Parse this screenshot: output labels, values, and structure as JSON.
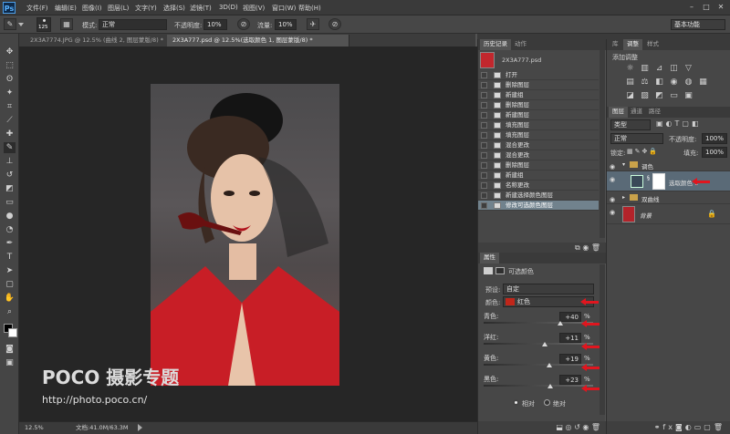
{
  "app": {
    "logo": "Ps"
  },
  "menubar": {
    "items": [
      "文件(F)",
      "编辑(E)",
      "图像(I)",
      "图层(L)",
      "文字(Y)",
      "选择(S)",
      "滤镜(T)",
      "3D(D)",
      "视图(V)",
      "窗口(W)",
      "帮助(H)"
    ],
    "window_controls": [
      "–",
      "□",
      "✕"
    ]
  },
  "options": {
    "brush_size": "125",
    "mode_label": "模式:",
    "mode_value": "正常",
    "opacity_label": "不透明度:",
    "opacity_value": "10%",
    "flow_label": "流量:",
    "flow_value": "10%",
    "workspace": "基本功能"
  },
  "tabs": [
    {
      "label": "2X3A7774.JPG @ 12.5% (曲线 2, 图层蒙版/8) *",
      "active": false
    },
    {
      "label": "2X3A777.psd @ 12.5%(选取颜色 1, 图层蒙版/8) *",
      "active": true
    }
  ],
  "status": {
    "zoom": "12.5%",
    "doc": "文档:41.0M/63.3M"
  },
  "watermark": {
    "brand": "POCO 摄影专题",
    "url": "http://photo.poco.cn/"
  },
  "history": {
    "tabs": [
      "历史记录",
      "动作"
    ],
    "snapshot": "2X3A777.psd",
    "items": [
      "打开",
      "删除图层",
      "新建组",
      "删除图层",
      "新建图层",
      "填充图层",
      "填充图层",
      "混合更改",
      "混合更改",
      "删除图层",
      "新建组",
      "名称更改",
      "新建选择颜色图层",
      "修改可选颜色图层"
    ],
    "selected_index": 13
  },
  "properties": {
    "tab": "属性",
    "title": "可选颜色",
    "preset_label": "预设:",
    "preset_value": "自定",
    "colors_label": "颜色:",
    "colors_value": "红色",
    "swatch_color": "#c0261a",
    "sliders": [
      {
        "label": "青色:",
        "value": "+40",
        "pct": "%",
        "position": 0.7
      },
      {
        "label": "洋红:",
        "value": "+11",
        "pct": "%",
        "position": 0.56
      },
      {
        "label": "黄色:",
        "value": "+19",
        "pct": "%",
        "position": 0.6
      },
      {
        "label": "黑色:",
        "value": "+23",
        "pct": "%",
        "position": 0.61
      }
    ],
    "method_relative": "相对",
    "method_absolute": "绝对"
  },
  "right_tabs": {
    "top": [
      "库",
      "调整",
      "样式"
    ],
    "add_adjustment": "添加调整"
  },
  "layers": {
    "tabs": [
      "图层",
      "通道",
      "路径"
    ],
    "kind_filter": "类型",
    "blend_mode": "正常",
    "opacity_label": "不透明度:",
    "opacity_value": "100%",
    "lock_label": "锁定:",
    "fill_label": "填充:",
    "fill_value": "100%",
    "rows": [
      {
        "name": "调色",
        "type": "group"
      },
      {
        "name": "选取颜色 1",
        "type": "adjustment"
      },
      {
        "name": "双曲线",
        "type": "group"
      },
      {
        "name": "背景",
        "type": "background"
      }
    ]
  },
  "annotation_color": "#e0161f"
}
